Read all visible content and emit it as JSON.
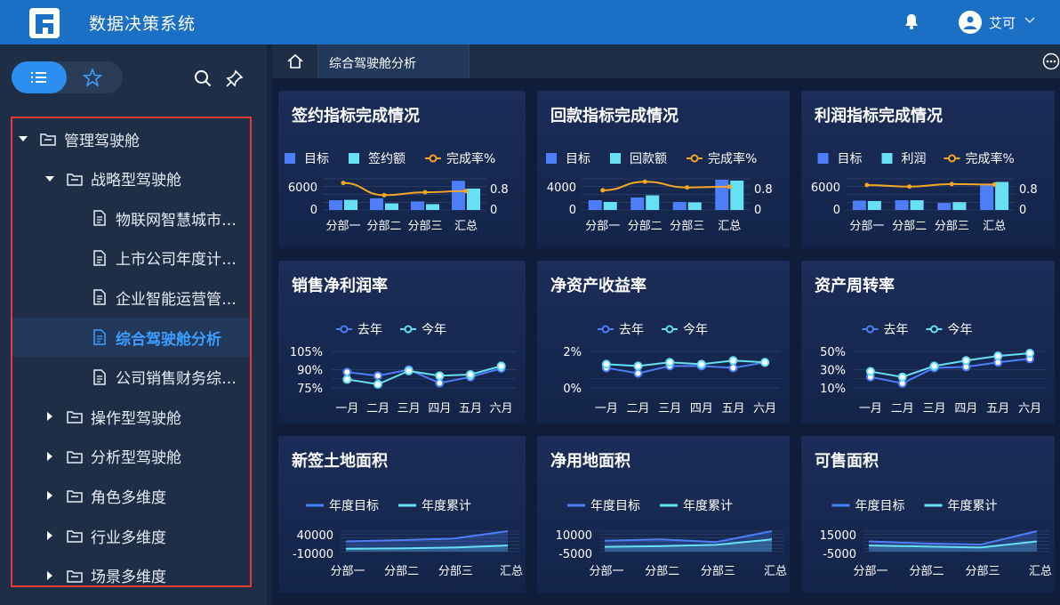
{
  "app": {
    "title": "数据决策系统",
    "user": "艾可"
  },
  "icons": {
    "logo": "fr-logo",
    "bell": "bell-icon",
    "avatar": "user-icon",
    "list": "list-icon",
    "star": "star-icon",
    "search": "search-icon",
    "pin": "pin-icon",
    "home": "home-icon",
    "more": "more-icon"
  },
  "colors": {
    "topbar": "#1b70c6",
    "accent": "#2b8ef0",
    "active_text": "#3e9cff",
    "bar_blue": "#4d7ef7",
    "bar_cyan": "#66e0f2",
    "line_orange": "#f5a623"
  },
  "tree": [
    {
      "label": "管理驾驶舱",
      "level": 0,
      "type": "folder",
      "expanded": true
    },
    {
      "label": "战略型驾驶舱",
      "level": 1,
      "type": "folder",
      "expanded": true
    },
    {
      "label": "物联网智慧城市…",
      "level": 2,
      "type": "file"
    },
    {
      "label": "上市公司年度计…",
      "level": 2,
      "type": "file"
    },
    {
      "label": "企业智能运营管…",
      "level": 2,
      "type": "file"
    },
    {
      "label": "综合驾驶舱分析",
      "level": 2,
      "type": "file",
      "active": true
    },
    {
      "label": "公司销售财务综…",
      "level": 2,
      "type": "file"
    },
    {
      "label": "操作型驾驶舱",
      "level": 1,
      "type": "folder",
      "expanded": false
    },
    {
      "label": "分析型驾驶舱",
      "level": 1,
      "type": "folder",
      "expanded": false
    },
    {
      "label": "角色多维度",
      "level": 1,
      "type": "folder",
      "expanded": false
    },
    {
      "label": "行业多维度",
      "level": 1,
      "type": "folder",
      "expanded": false
    },
    {
      "label": "场景多维度",
      "level": 1,
      "type": "folder",
      "expanded": false
    }
  ],
  "tabs": {
    "active": "综合驾驶舱分析"
  },
  "chart_data": [
    {
      "type": "bar",
      "title": "签约指标完成情况",
      "categories": [
        "分部一",
        "分部二",
        "分部三",
        "汇总"
      ],
      "series": [
        {
          "name": "目标",
          "kind": "bar",
          "values": [
            2500,
            3000,
            2200,
            7500
          ]
        },
        {
          "name": "签约额",
          "kind": "bar",
          "values": [
            2600,
            1700,
            1500,
            5500
          ]
        },
        {
          "name": "完成率%",
          "kind": "line",
          "axis": "right",
          "values": [
            1.04,
            0.57,
            0.68,
            0.73
          ]
        }
      ],
      "ylim": [
        0,
        8000
      ],
      "yticks": [
        "6000",
        "0"
      ],
      "y2ticks": [
        "0.8",
        "0"
      ],
      "y2lim": [
        0,
        1.2
      ]
    },
    {
      "type": "bar",
      "title": "回款指标完成情况",
      "categories": [
        "分部一",
        "分部二",
        "分部三",
        "汇总"
      ],
      "series": [
        {
          "name": "目标",
          "kind": "bar",
          "values": [
            2200,
            2800,
            1800,
            6800
          ]
        },
        {
          "name": "回款额",
          "kind": "bar",
          "values": [
            1800,
            3300,
            1700,
            6600
          ]
        },
        {
          "name": "完成率%",
          "kind": "line",
          "axis": "right",
          "values": [
            0.82,
            1.18,
            0.94,
            0.97
          ]
        }
      ],
      "ylim": [
        0,
        7000
      ],
      "yticks": [
        "4000",
        "0"
      ],
      "y2ticks": [
        "0.8",
        "0"
      ],
      "y2lim": [
        0,
        1.3
      ]
    },
    {
      "type": "bar",
      "title": "利润指标完成情况",
      "categories": [
        "分部一",
        "分部二",
        "分部三",
        "汇总"
      ],
      "series": [
        {
          "name": "目标",
          "kind": "bar",
          "values": [
            2400,
            2500,
            1800,
            6500
          ]
        },
        {
          "name": "利润",
          "kind": "bar",
          "values": [
            2300,
            2500,
            2000,
            7200
          ]
        },
        {
          "name": "完成率%",
          "kind": "line",
          "axis": "right",
          "values": [
            0.96,
            0.9,
            1.0,
            0.98
          ]
        }
      ],
      "ylim": [
        0,
        8000
      ],
      "yticks": [
        "6000",
        "0"
      ],
      "y2ticks": [
        "0.8",
        "0"
      ],
      "y2lim": [
        0,
        1.2
      ]
    },
    {
      "type": "line",
      "title": "销售净利润率",
      "categories": [
        "一月",
        "二月",
        "三月",
        "四月",
        "五月",
        "六月"
      ],
      "series": [
        {
          "name": "去年",
          "values": [
            88,
            85,
            90,
            79,
            84,
            91
          ]
        },
        {
          "name": "今年",
          "values": [
            82,
            78,
            89,
            85,
            86,
            93
          ]
        }
      ],
      "ylim": [
        75,
        105
      ],
      "yticks": [
        "105%",
        "90%",
        "75%"
      ]
    },
    {
      "type": "line",
      "title": "净资产收益率",
      "categories": [
        "一月",
        "二月",
        "三月",
        "四月",
        "五月",
        "六月"
      ],
      "series": [
        {
          "name": "去年",
          "values": [
            1.1,
            0.8,
            1.2,
            1.2,
            1.1,
            1.4
          ]
        },
        {
          "name": "今年",
          "values": [
            1.3,
            1.2,
            1.4,
            1.3,
            1.5,
            1.4
          ]
        }
      ],
      "ylim": [
        0,
        2
      ],
      "yticks": [
        "2%",
        "0%"
      ]
    },
    {
      "type": "line",
      "title": "资产周转率",
      "categories": [
        "一月",
        "二月",
        "三月",
        "四月",
        "五月",
        "六月"
      ],
      "series": [
        {
          "name": "去年",
          "values": [
            22,
            15,
            32,
            33,
            38,
            42
          ]
        },
        {
          "name": "今年",
          "values": [
            28,
            22,
            34,
            40,
            45,
            48
          ]
        }
      ],
      "ylim": [
        10,
        50
      ],
      "yticks": [
        "50%",
        "30%",
        "10%"
      ]
    },
    {
      "type": "area",
      "title": "新签土地面积",
      "categories": [
        "分部一",
        "分部二",
        "分部三",
        "汇总"
      ],
      "series": [
        {
          "name": "年度目标",
          "values": [
            15000,
            18000,
            22000,
            40000
          ]
        },
        {
          "name": "年度累计",
          "values": [
            -3000,
            -2000,
            0,
            5000
          ]
        }
      ],
      "ylim": [
        -10000,
        40000
      ],
      "yticks": [
        "40000",
        "-10000"
      ]
    },
    {
      "type": "area",
      "title": "净用地面积",
      "categories": [
        "分部一",
        "分部二",
        "分部三",
        "汇总"
      ],
      "series": [
        {
          "name": "年度目标",
          "values": [
            3000,
            4000,
            2000,
            10000
          ]
        },
        {
          "name": "年度累计",
          "values": [
            -1500,
            -1000,
            0,
            4000
          ]
        }
      ],
      "ylim": [
        -5000,
        10000
      ],
      "yticks": [
        "10000",
        "-5000"
      ]
    },
    {
      "type": "area",
      "title": "可售面积",
      "categories": [
        "分部一",
        "分部二",
        "分部三",
        "汇总"
      ],
      "series": [
        {
          "name": "年度目标",
          "values": [
            5000,
            3000,
            2000,
            15000
          ]
        },
        {
          "name": "年度累计",
          "values": [
            1000,
            0,
            -1000,
            5000
          ]
        }
      ],
      "ylim": [
        -5000,
        15000
      ],
      "yticks": [
        "15000",
        "-5000"
      ]
    }
  ]
}
